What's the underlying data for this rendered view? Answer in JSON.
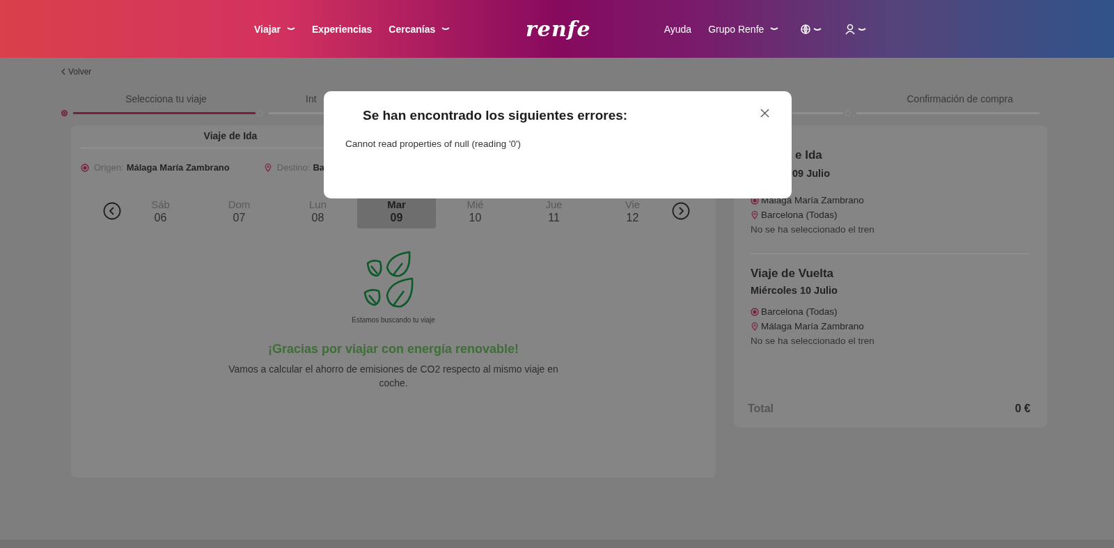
{
  "header": {
    "nav_left": [
      {
        "label": "Viajar",
        "dropdown": true
      },
      {
        "label": "Experiencias",
        "dropdown": false
      },
      {
        "label": "Cercanías",
        "dropdown": true
      }
    ],
    "logo": "renfe",
    "nav_right": [
      {
        "label": "Ayuda",
        "dropdown": false
      },
      {
        "label": "Grupo Renfe",
        "dropdown": true
      }
    ],
    "icon_menus": [
      {
        "kind": "globe"
      },
      {
        "kind": "user"
      }
    ]
  },
  "back_link": "Volver",
  "steps": [
    {
      "label": "Selecciona tu viaje",
      "selected": true
    },
    {
      "label": "Int",
      "selected": false
    },
    {
      "selected": false
    },
    {
      "label": "Confirmación de compra",
      "selected": false
    }
  ],
  "trip": {
    "tab": "Viaje de Ida",
    "origin_label": "Origen:",
    "origin": "Málaga María Zambrano",
    "destination_label": "Destino:",
    "destination": "Ba",
    "days": [
      {
        "weekday": "Sáb",
        "day": "06",
        "selected": false
      },
      {
        "weekday": "Dom",
        "day": "07",
        "selected": false
      },
      {
        "weekday": "Lun",
        "day": "08",
        "selected": false
      },
      {
        "weekday": "Mar",
        "day": "09",
        "selected": true
      },
      {
        "weekday": "Mié",
        "day": "10",
        "selected": false
      },
      {
        "weekday": "Jue",
        "day": "11",
        "selected": false
      },
      {
        "weekday": "Vie",
        "day": "12",
        "selected": false
      }
    ],
    "loading_caption": "Estamos buscando tu viaje",
    "eco_title": "¡Gracias por viajar con energía renovable!",
    "eco_text": "Vamos a calcular el ahorro de emisiones de CO2 respecto al mismo viaje en coche."
  },
  "summary": {
    "outbound": {
      "title": "e Ida",
      "date": "09 Julio",
      "from": "Málaga María Zambrano",
      "to": "Barcelona (Todas)",
      "train": "No se ha seleccionado el tren"
    },
    "return": {
      "title": "Viaje de Vuelta",
      "date": "Miércoles 10 Julio",
      "from": "Barcelona (Todas)",
      "to": "Málaga María Zambrano",
      "train": "No se ha seleccionado el tren"
    },
    "total_label": "Total",
    "total": "0 €"
  },
  "modal": {
    "title": "Se han encontrado los siguientes errores:",
    "message": "Cannot read properties of null (reading '0')"
  }
}
